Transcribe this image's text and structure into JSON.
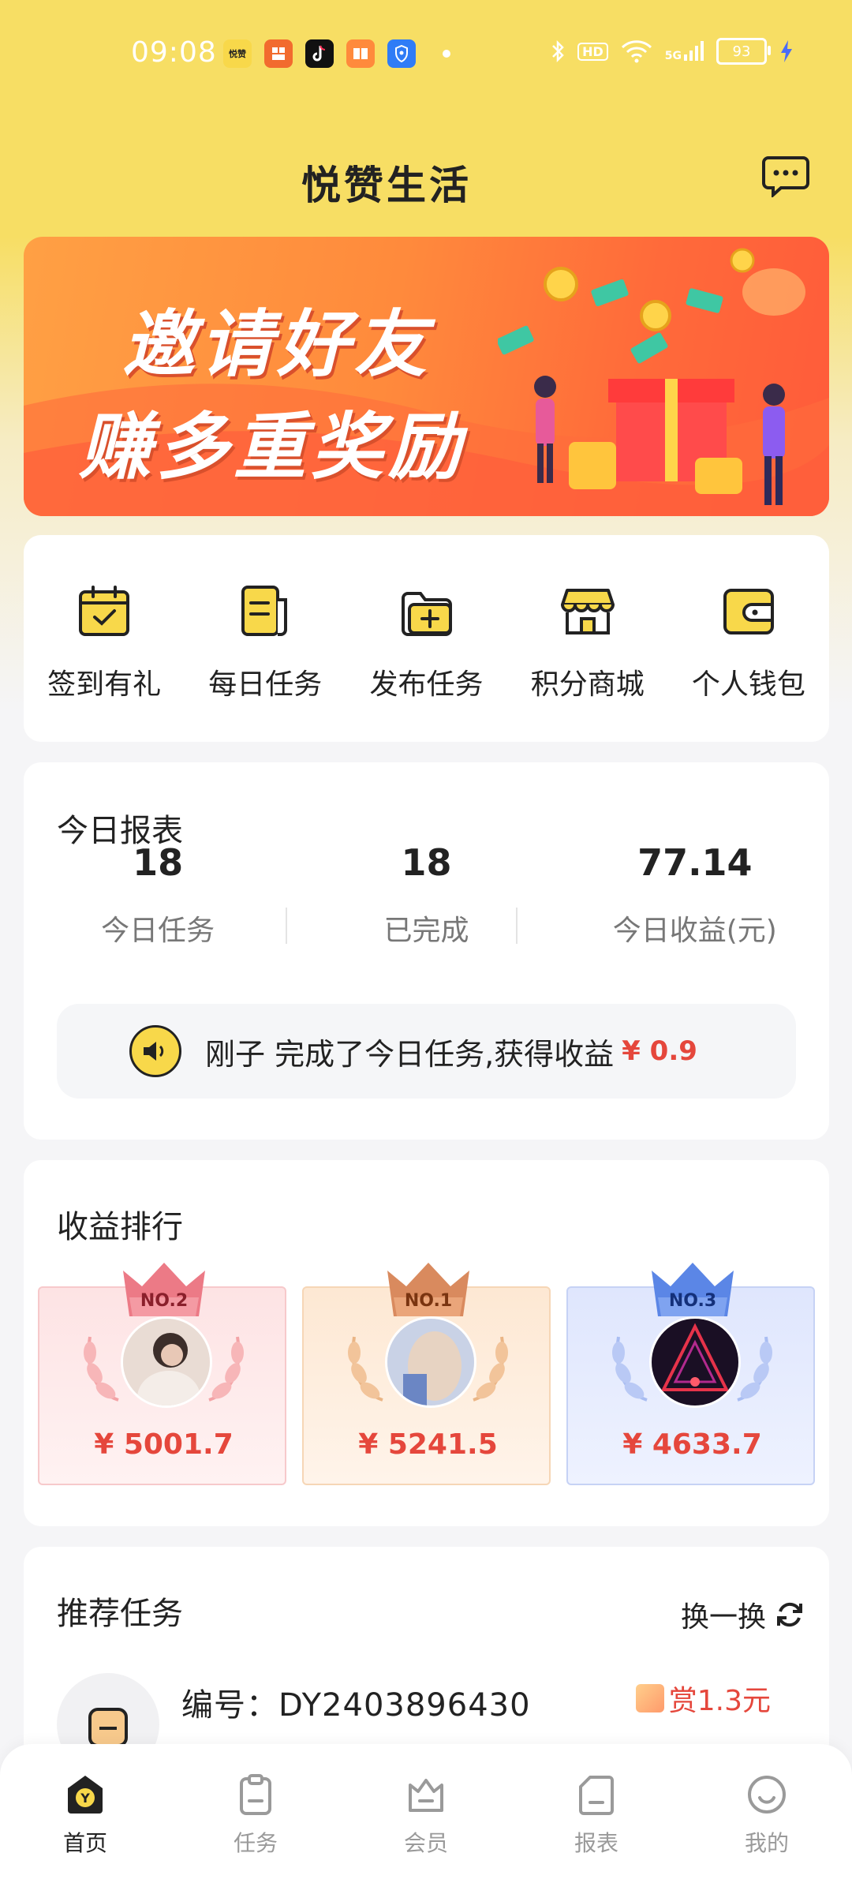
{
  "status_bar": {
    "time": "09:08",
    "apps": [
      {
        "name": "yuezan-app-icon",
        "label": "悦赞",
        "color": "#f8d84a"
      },
      {
        "name": "app-icon-orange",
        "label": "",
        "color": "#f26b2e"
      },
      {
        "name": "tiktok-app-icon",
        "label": "",
        "color": "#111111"
      },
      {
        "name": "book-app-icon",
        "label": "",
        "color": "#ff8a3c"
      },
      {
        "name": "shield-app-icon",
        "label": "",
        "color": "#2f7cf6"
      }
    ],
    "hd_label": "HD",
    "signal_label": "5G",
    "battery": "93"
  },
  "header": {
    "title": "悦赞生活"
  },
  "banner": {
    "line1": "邀请好友",
    "line2": "赚多重奖励"
  },
  "quick_actions": [
    {
      "label": "签到有礼",
      "icon": "calendar-check-icon"
    },
    {
      "label": "每日任务",
      "icon": "task-list-icon"
    },
    {
      "label": "发布任务",
      "icon": "folder-add-icon"
    },
    {
      "label": "积分商城",
      "icon": "store-icon"
    },
    {
      "label": "个人钱包",
      "icon": "wallet-icon"
    }
  ],
  "report": {
    "title": "今日报表",
    "stats": [
      {
        "value": "18",
        "label": "今日任务"
      },
      {
        "value": "18",
        "label": "已完成"
      },
      {
        "value": "77.14",
        "label": "今日收益(元)"
      }
    ],
    "notice_text": "刚子 完成了今日任务,获得收益",
    "notice_amount": "¥ 0.9"
  },
  "ranking": {
    "title": "收益排行",
    "entries": [
      {
        "rank": "NO.2",
        "amount": "¥ 5001.7",
        "theme": "pink"
      },
      {
        "rank": "NO.1",
        "amount": "¥ 5241.5",
        "theme": "gold"
      },
      {
        "rank": "NO.3",
        "amount": "¥ 4633.7",
        "theme": "blue"
      }
    ]
  },
  "recommend": {
    "title": "推荐任务",
    "refresh_label": "换一换",
    "task_id": "编号：DY2403896430",
    "reward": "赏1.3元"
  },
  "bottom_nav": [
    {
      "label": "首页",
      "active": true
    },
    {
      "label": "任务",
      "active": false
    },
    {
      "label": "会员",
      "active": false
    },
    {
      "label": "报表",
      "active": false
    },
    {
      "label": "我的",
      "active": false
    }
  ],
  "colors": {
    "brand_yellow": "#f7de64",
    "accent_red": "#e5473c",
    "banner_orange": "#ff8a3c"
  }
}
